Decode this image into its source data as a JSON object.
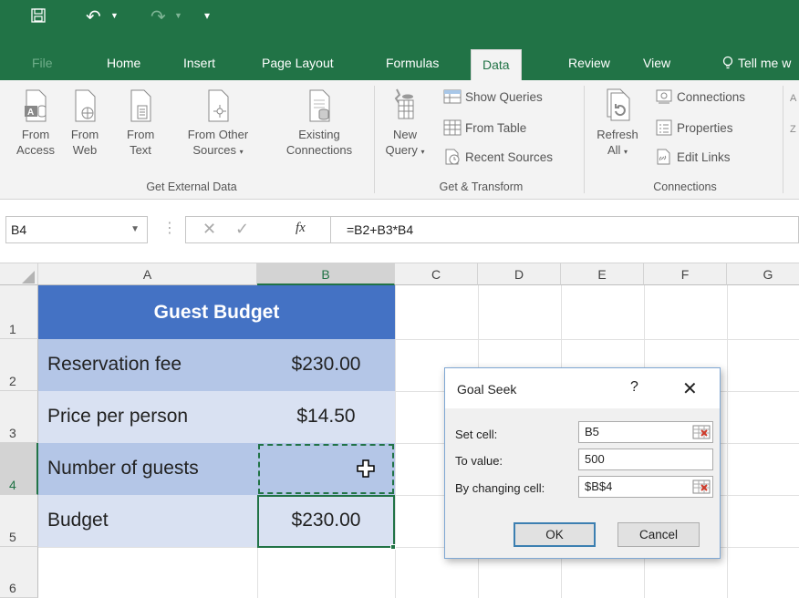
{
  "ribbon_tabs": [
    "File",
    "Home",
    "Insert",
    "Page Layout",
    "Formulas",
    "Data",
    "Review",
    "View",
    "Tell me w"
  ],
  "active_tab": "Data",
  "get_external_data": {
    "from_access": [
      "From",
      "Access"
    ],
    "from_web": [
      "From",
      "Web"
    ],
    "from_text": [
      "From",
      "Text"
    ],
    "from_other": [
      "From Other",
      "Sources"
    ],
    "existing": [
      "Existing",
      "Connections"
    ],
    "group_label": "Get External Data"
  },
  "get_transform": {
    "new_query": [
      "New",
      "Query"
    ],
    "show_queries": "Show Queries",
    "from_table": "From Table",
    "recent_sources": "Recent Sources",
    "group_label": "Get & Transform"
  },
  "connections": {
    "refresh_all": [
      "Refresh",
      "All"
    ],
    "connections": "Connections",
    "properties": "Properties",
    "edit_links": "Edit Links",
    "group_label": "Connections"
  },
  "formula_bar": {
    "name_box": "B4",
    "fx": "fx",
    "formula": "=B2+B3*B4"
  },
  "columns": [
    "A",
    "B",
    "C",
    "D",
    "E",
    "F",
    "G"
  ],
  "rows": [
    "1",
    "2",
    "3",
    "4",
    "5",
    "6"
  ],
  "sheet": {
    "title": "Guest Budget",
    "row2": {
      "label": "Reservation fee",
      "value": "$230.00"
    },
    "row3": {
      "label": "Price per person",
      "value": "$14.50"
    },
    "row4": {
      "label": "Number of guests",
      "value": ""
    },
    "row5": {
      "label": "Budget",
      "value": "$230.00"
    }
  },
  "colors": {
    "excel_green": "#217346",
    "header_blue": "#4472c4",
    "row_blue_dark": "#b4c6e7",
    "row_blue_light": "#d9e1f2"
  },
  "goal_seek": {
    "title": "Goal Seek",
    "help": "?",
    "close": "✕",
    "set_cell_label": "Set cell:",
    "set_cell_value": "B5",
    "to_value_label": "To value:",
    "to_value_value": "500",
    "by_changing_label": "By changing cell:",
    "by_changing_value": "$B$4",
    "ok": "OK",
    "cancel": "Cancel"
  }
}
